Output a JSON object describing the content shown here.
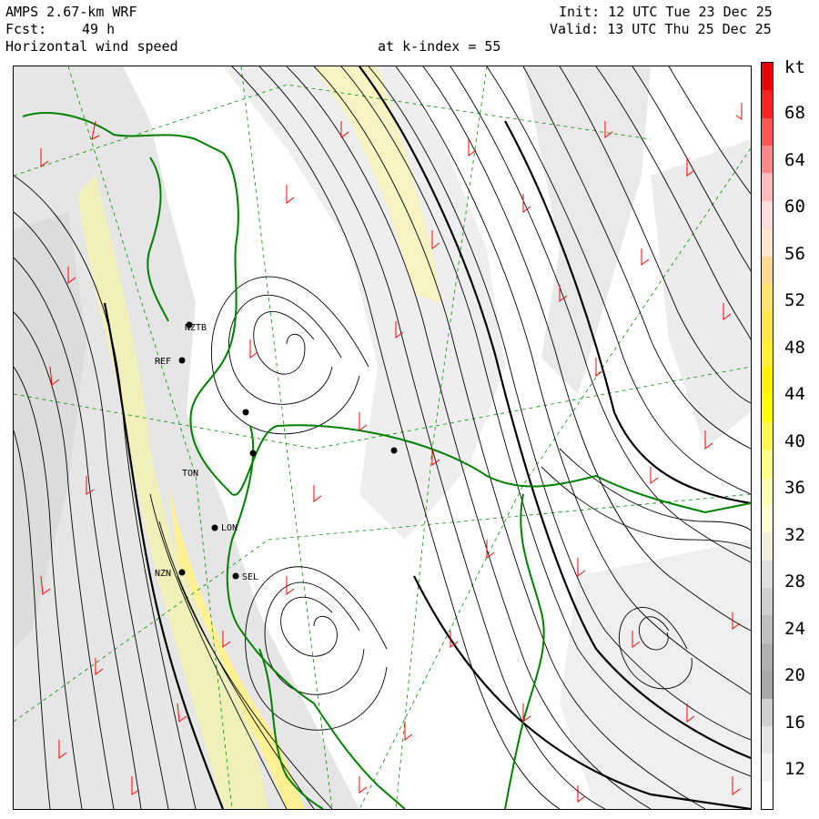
{
  "header": {
    "model": "AMPS 2.67-km WRF",
    "forecast_label": "Fcst:",
    "forecast_hours": "49 h",
    "field": "Horizontal wind speed",
    "level": "at k-index = 55",
    "init": "Init: 12 UTC Tue 23 Dec 25",
    "valid": "Valid: 13 UTC Thu 25 Dec 25"
  },
  "colorbar": {
    "unit": "kt",
    "labels": [
      "68",
      "64",
      "60",
      "56",
      "52",
      "48",
      "44",
      "40",
      "36",
      "32",
      "28",
      "24",
      "20",
      "16",
      "12"
    ],
    "colors": [
      "#ee0000",
      "#ff2222",
      "#ff5555",
      "#ff8888",
      "#ffbbbb",
      "#ffdddd",
      "#ffe8cc",
      "#ffd98f",
      "#ffe270",
      "#ffe64c",
      "#ffee33",
      "#fff200",
      "#ffff00",
      "#fff74d",
      "#ffff88",
      "#ffffb0",
      "#ffffd0",
      "#f0f0dc",
      "#e0e0e0",
      "#d0d0d0",
      "#c0c0c0",
      "#b0b0b0",
      "#a8a8a8",
      "#cfcfcf",
      "#e4e4e4",
      "#f2f2f2",
      "#ffffff"
    ]
  },
  "stations": [
    "NZTB",
    "REF",
    "TON",
    "SEL",
    "LON",
    "NZN"
  ],
  "colors": {
    "coast": "#008000",
    "barb": "#ff0000",
    "streamline": "#000000",
    "grid": "#009000"
  }
}
